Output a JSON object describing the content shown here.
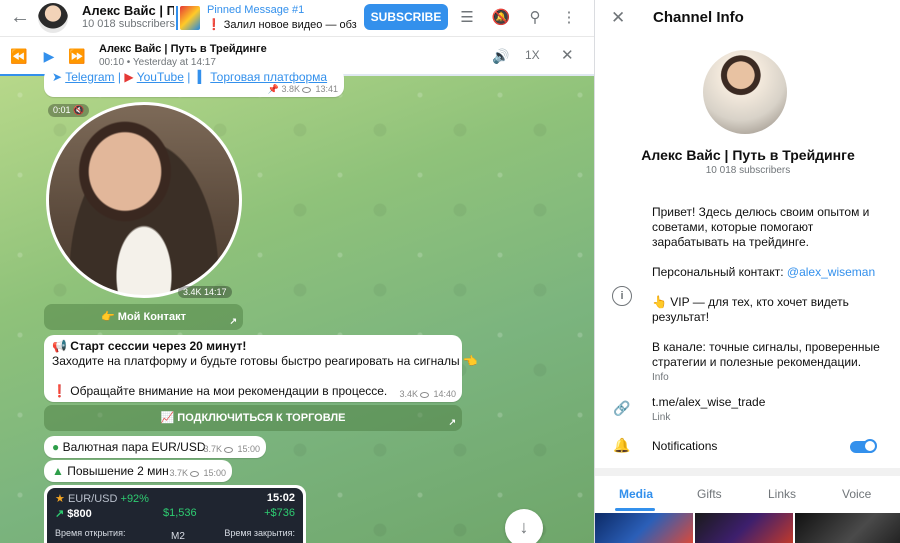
{
  "header": {
    "channel_title": "Алекс Вайс | Пут",
    "subscribers": "10 018 subscribers",
    "pinned_title": "Pinned Message #1",
    "pinned_text": "❗ Залил новое видео — обз...",
    "subscribe_label": "SUBSCRIBE"
  },
  "player": {
    "title": "Алекс Вайс | Путь в Трейдинге",
    "subtitle": "00:10 • Yesterday at 14:17",
    "speed": "1X",
    "progress": 0.12
  },
  "messages": {
    "links_line": {
      "telegram": "Telegram",
      "sep1": "|",
      "youtube": "YouTube",
      "sep2": "|",
      "platform": "Торговая платформа",
      "views": "3.8K",
      "time": "13:41"
    },
    "video": {
      "duration": "0:01",
      "views": "3.4K",
      "time": "14:17"
    },
    "contact_button": "👉 Мой Контакт",
    "session": {
      "title": "Старт сессии через 20 минут!",
      "line2": "Заходите на платформу и будьте готовы быстро реагировать на сигналы 👈",
      "line3": "Обращайте внимание на мои рекомендации в процессе.",
      "views": "3.4K",
      "time": "14:40"
    },
    "connect_button": "📈 ПОДКЛЮЧИТЬСЯ К ТОРГОВЛЕ",
    "pair": {
      "text": "Валютная пара EUR/USD",
      "views": "3.7K",
      "time": "15:00"
    },
    "raise": {
      "text": "Повышение 2 мин",
      "views": "3.7K",
      "time": "15:00"
    },
    "trade_card": {
      "pair": "EUR/USD",
      "percent": "+92%",
      "time": "15:02",
      "amount": "$800",
      "payout": "$1,536",
      "profit": "+$736",
      "open_label": "Время открытия:",
      "timeframe": "M2",
      "close_label": "Время закрытия:"
    }
  },
  "panel": {
    "title": "Channel Info",
    "name": "Алекс Вайс | Путь в Трейдинге",
    "subscribers": "10 018 subscribers",
    "about_p1": "Привет! Здесь делюсь своим опытом и советами, которые помогают зарабатывать на трейдинге.",
    "about_p2_prefix": "Персональный контакт: ",
    "about_p2_link": "@alex_wiseman",
    "about_p3": "👆 VIP — для тех, кто хочет видеть результат!",
    "about_p4": "В канале: точные сигналы, проверенные стратегии и полезные рекомендации.",
    "info_label": "Info",
    "link_value": "t.me/alex_wise_trade",
    "link_label": "Link",
    "notifications_label": "Notifications",
    "notifications_on": true,
    "tabs": [
      "Media",
      "Gifts",
      "Links",
      "Voice"
    ],
    "active_tab": "Media"
  },
  "colors": {
    "accent": "#3390ec",
    "green_text": "#2e9e4a",
    "red_mark": "#e53935"
  }
}
